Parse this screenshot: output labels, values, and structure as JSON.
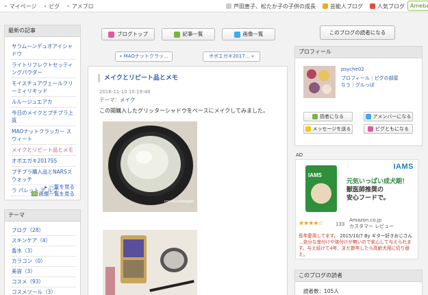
{
  "topbar": {
    "nav": [
      "マイページ",
      "ピグ",
      "アメブロ"
    ],
    "right": [
      {
        "label": "芦田恵子、松たか子の子供の成長",
        "color": "#cccccc"
      },
      {
        "label": "芸能人ブログ",
        "color": "#f5a623"
      },
      {
        "label": "人気ブログ",
        "color": "#e74c3c"
      }
    ],
    "ameba": "Ameba"
  },
  "sidebar": {
    "recent_title": "最新の記事",
    "recent_items": [
      {
        "label": "サラムーンデュオアイシャドウ",
        "current": false
      },
      {
        "label": "ライトリフレクトセッティングパウダー",
        "current": false
      },
      {
        "label": "モイスチュアヴェールクリーミィリキッド",
        "current": false
      },
      {
        "label": "ルルージュエアカ",
        "current": false
      },
      {
        "label": "今日のメイクとプチプラ上質",
        "current": false
      },
      {
        "label": "MAOナットクラッカー スウィート",
        "current": false
      },
      {
        "label": "メイクとリピート品とメモ",
        "current": true
      },
      {
        "label": "オボエガキ2017SS",
        "current": false
      },
      {
        "label": "プチプラ購入品とNARSスウォッチ",
        "current": false
      },
      {
        "label": "ラ パレット デ ルヴ",
        "current": false
      }
    ],
    "more_list": "一覧を見る",
    "more_images": "画像一覧を見る",
    "theme_title": "テーマ",
    "theme_items": [
      "ブログ（28）",
      "スキンケア（4）",
      "香水（3）",
      "カラコン（0）",
      "美容（3）",
      "コスメ（93）",
      "コスメツール（3）"
    ]
  },
  "main": {
    "buttons": [
      {
        "label": "ブログトップ",
        "color": "#e05a9b"
      },
      {
        "label": "記事一覧",
        "color": "#7cb342"
      },
      {
        "label": "画像一覧",
        "color": "#3fa9f5"
      }
    ],
    "prev": "« MAOナットクラッ…",
    "next": "オボエガキ2017… »",
    "article": {
      "title": "メイクとリピート品とメモ",
      "date": "2016-11-10 15:19:48",
      "theme_label": "テーマ：",
      "theme_value": "メイク",
      "body": "この間購入したグリッターシャドウをベースにメイクしてみました。",
      "watermark": "cosme+oboegaki"
    }
  },
  "right": {
    "readers_button": "このブログの読者になる",
    "profile_title": "プロフィール",
    "username": "psyche02",
    "links": [
      "プロフィール",
      "ピグの部屋",
      "なう",
      "グルっぽ"
    ],
    "buttons": [
      {
        "label": "読者になる",
        "color": "#7cb342"
      },
      {
        "label": "アメンバーになる",
        "color": "#3fa9f5"
      },
      {
        "label": "メッセージを送る",
        "color": "#f5c518"
      },
      {
        "label": "ピグともになる",
        "color": "#e05a9b"
      }
    ],
    "ad_label": "AD",
    "ad": {
      "brand": "IAMS",
      "bag_label": "IAMS",
      "copy_line1": "元気いっぱい成犬期！",
      "copy_line2": "獣医師推奨の",
      "copy_line3": "安心フードで。",
      "stars": "★★★★☆",
      "count": "133",
      "amazon_line1": "Amazon.co.jp",
      "amazon_line2": "カスタマー レビュー",
      "review_head": "長年愛用してます。",
      "review_meta": "2015/10/7 By ギター好きおじさん",
      "review_body": "…余分な食付けや体付けが無いので安心して与えられます。与え続けて4年、まだ数年したら高齢犬用に切り替え。"
    },
    "readers_title": "このブログの読者",
    "readers_count": "読者数：105人"
  }
}
